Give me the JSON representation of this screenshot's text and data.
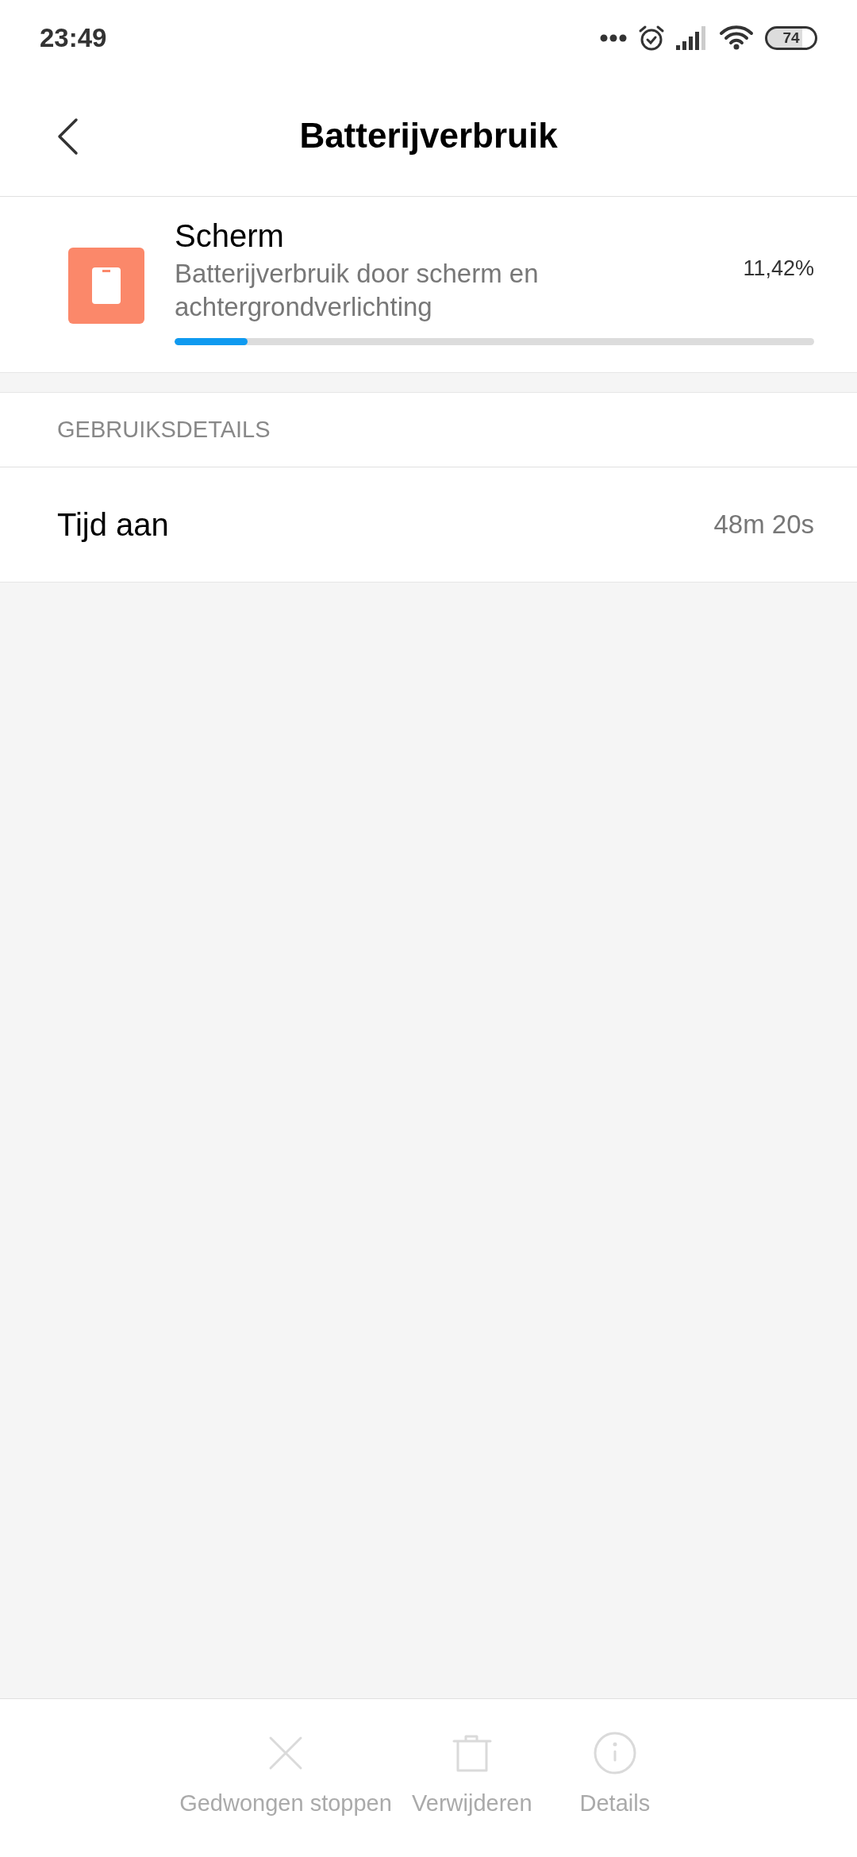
{
  "status_bar": {
    "time": "23:49",
    "battery": "74"
  },
  "header": {
    "title": "Batterijverbruik"
  },
  "usage": {
    "title": "Scherm",
    "description": "Batterijverbruik door scherm en achtergrondverlichting",
    "percent": "11,42%",
    "level": 0.1142
  },
  "details": {
    "heading": "GEBRUIKSDETAILS",
    "rows": [
      {
        "label": "Tijd aan",
        "value": "48m 20s"
      }
    ]
  },
  "actions": [
    {
      "kind": "stop",
      "label": "Gedwongen stoppen",
      "disabled": true
    },
    {
      "kind": "delete",
      "label": "Verwijderen",
      "disabled": true
    },
    {
      "kind": "info",
      "label": "Details",
      "disabled": true
    }
  ]
}
